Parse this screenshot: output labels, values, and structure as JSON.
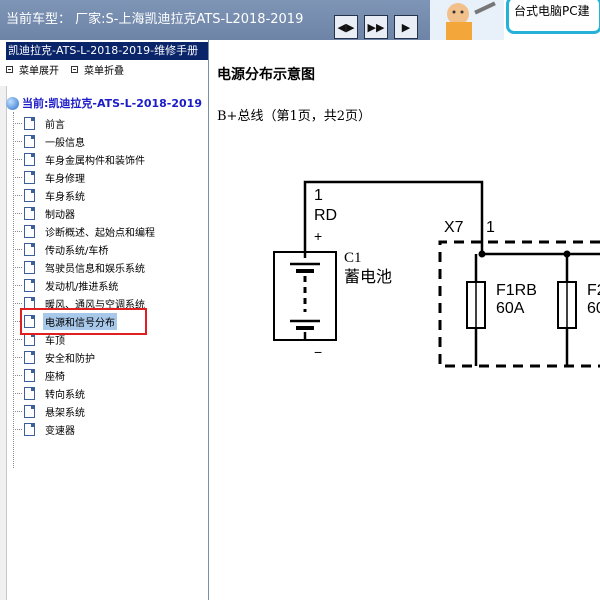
{
  "header": {
    "title_prefix": "当前车型：",
    "title_value": "厂家:S-上海凯迪拉克ATS-L2018-2019",
    "nav_buttons": [
      "◀▶",
      "▶▶",
      "▶"
    ],
    "promo_text": "台式电脑PC建"
  },
  "sidebar": {
    "manual_title": "凯迪拉克-ATS-L-2018-2019-维修手册",
    "expand_label": "菜单展开",
    "collapse_label": "菜单折叠",
    "root_label": "当前:凯迪拉克-ATS-L-2018-2019",
    "items": [
      {
        "label": "前言"
      },
      {
        "label": "一般信息"
      },
      {
        "label": "车身金属构件和装饰件"
      },
      {
        "label": "车身修理"
      },
      {
        "label": "车身系统"
      },
      {
        "label": "制动器"
      },
      {
        "label": "诊断概述、起始点和编程"
      },
      {
        "label": "传动系统/车桥"
      },
      {
        "label": "驾驶员信息和娱乐系统"
      },
      {
        "label": "发动机/推进系统"
      },
      {
        "label": "暖风、通风与空调系统"
      },
      {
        "label": "电源和信号分布",
        "selected": true
      },
      {
        "label": "车顶"
      },
      {
        "label": "安全和防护"
      },
      {
        "label": "座椅"
      },
      {
        "label": "转向系统"
      },
      {
        "label": "悬架系统"
      },
      {
        "label": "变速器"
      }
    ]
  },
  "content": {
    "title": "电源分布示意图",
    "subtitle": "B+总线（第1页，共2页）",
    "diagram": {
      "wire_pin": "1",
      "wire_color": "RD",
      "plus": "+",
      "minus": "−",
      "battery_id": "C1",
      "battery_name": "蓄电池",
      "connector": "X7",
      "connector_pin": "1",
      "fuse1_name": "F1RB",
      "fuse1_rating": "60A",
      "fuse2_name": "F2",
      "fuse2_rating": "60"
    }
  },
  "colors": {
    "header_bg": "#7388aa",
    "manual_title_bg": "#0a246a",
    "root_label": "#1b1bc8",
    "selection_box": "#e02020",
    "selected_bg": "#a8c8ea",
    "promo_border": "#26b2d8"
  }
}
